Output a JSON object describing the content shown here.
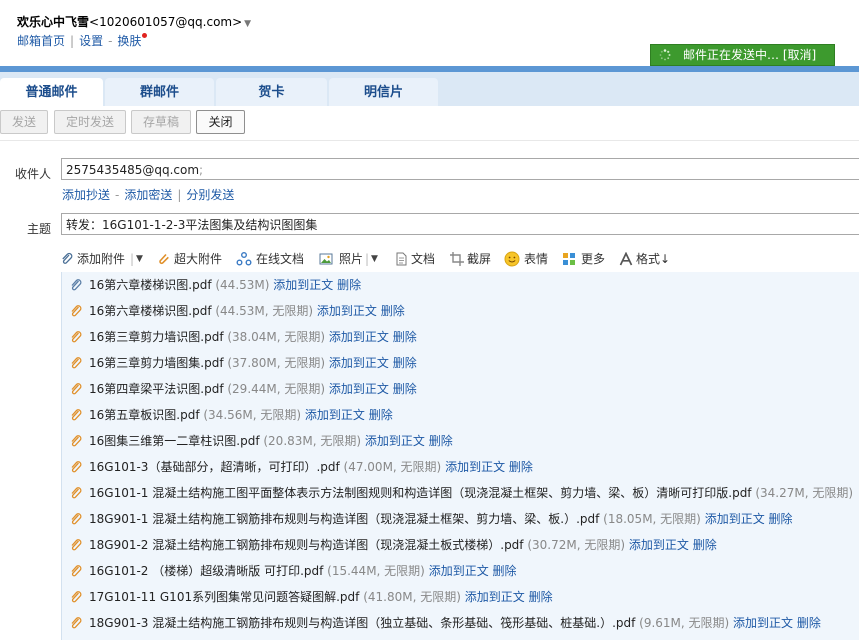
{
  "header": {
    "nickname": "欢乐心中飞雪",
    "email": "<1020601057@qq.com>",
    "dropdown": "▼",
    "links": [
      "邮箱首页",
      "设置",
      "换肤"
    ],
    "link_seps": [
      "|",
      "-"
    ],
    "sending_status": "邮件正在发送中…",
    "cancel": "[取消]"
  },
  "tabs": [
    "普通邮件",
    "群邮件",
    "贺卡",
    "明信片"
  ],
  "toolbar": {
    "send": "发送",
    "scheduled": "定时发送",
    "draft": "存草稿",
    "close": "关闭"
  },
  "form": {
    "to_label": "收件人",
    "to_value": "2575435485@qq.com",
    "to_separator": ";",
    "cc_links": [
      "添加抄送",
      "添加密送",
      "分别发送"
    ],
    "cc_seps": [
      "-",
      "|"
    ],
    "subject_label": "主题",
    "subject_value": "转发：16G101-1-2-3平法图集及结构识图图集"
  },
  "attach_tools": [
    {
      "label": "添加附件",
      "icon": "paperclip-icon"
    },
    {
      "label": "超大附件",
      "icon": "large-attachment-icon"
    },
    {
      "label": "在线文档",
      "icon": "online-doc-icon"
    },
    {
      "label": "照片",
      "icon": "photo-icon"
    },
    {
      "label": "文档",
      "icon": "document-icon"
    },
    {
      "label": "截屏",
      "icon": "screenshot-icon"
    },
    {
      "label": "表情",
      "icon": "emoji-icon"
    },
    {
      "label": "更多",
      "icon": "more-grid-icon"
    },
    {
      "label": "格式↓",
      "icon": "format-icon"
    }
  ],
  "tool_separator": "|",
  "tool_dropdown": "▼",
  "attachments": [
    {
      "name": "16第六章楼梯识图.pdf",
      "meta": " (44.53M) ",
      "add": "添加到正文",
      "del": "删除"
    },
    {
      "name": "16第六章楼梯识图.pdf",
      "meta": " (44.53M, 无限期) ",
      "add": "添加到正文",
      "del": "删除"
    },
    {
      "name": "16第三章剪力墙识图.pdf",
      "meta": " (38.04M, 无限期) ",
      "add": "添加到正文",
      "del": "删除"
    },
    {
      "name": "16第三章剪力墙图集.pdf",
      "meta": " (37.80M, 无限期) ",
      "add": "添加到正文",
      "del": "删除"
    },
    {
      "name": "16第四章梁平法识图.pdf",
      "meta": " (29.44M, 无限期) ",
      "add": "添加到正文",
      "del": "删除"
    },
    {
      "name": "16第五章板识图.pdf",
      "meta": " (34.56M, 无限期) ",
      "add": "添加到正文",
      "del": "删除"
    },
    {
      "name": "16图集三维第一二章柱识图.pdf",
      "meta": " (20.83M, 无限期) ",
      "add": "添加到正文",
      "del": "删除"
    },
    {
      "name": "16G101-3（基础部分，超清晰，可打印）.pdf",
      "meta": " (47.00M, 无限期) ",
      "add": "添加到正文",
      "del": "删除"
    },
    {
      "name": "16G101-1 混凝土结构施工图平面整体表示方法制图规则和构造详图（现浇混凝土框架、剪力墙、梁、板）清晰可打印版.pdf",
      "meta": " (34.27M, 无限期) ",
      "add": "",
      "del": ""
    },
    {
      "name": "18G901-1 混凝土结构施工钢筋排布规则与构造详图（现浇混凝土框架、剪力墙、梁、板.）.pdf",
      "meta": " (18.05M, 无限期) ",
      "add": "添加到正文",
      "del": "删除"
    },
    {
      "name": "18G901-2 混凝土结构施工钢筋排布规则与构造详图（现浇混凝土板式楼梯）.pdf",
      "meta": " (30.72M, 无限期) ",
      "add": "添加到正文",
      "del": "删除"
    },
    {
      "name": "16G101-2 （楼梯）超级清晰版 可打印.pdf",
      "meta": " (15.44M, 无限期) ",
      "add": "添加到正文",
      "del": "删除"
    },
    {
      "name": "17G101-11 G101系列图集常见问题答疑图解.pdf",
      "meta": " (41.80M, 无限期) ",
      "add": "添加到正文",
      "del": "删除"
    },
    {
      "name": "18G901-3 混凝土结构施工钢筋排布规则与构造详图（独立基础、条形基础、筏形基础、桩基础.）.pdf",
      "meta": " (9.61M, 无限期) ",
      "add": "添加到正文",
      "del": "删除"
    }
  ],
  "colors": {
    "link": "#1f5aa6",
    "sending_bg": "#3d9a2e",
    "tab_bar": "#5c97d4",
    "attach_bg": "#f0f6fc",
    "clip": "#e0902a"
  }
}
